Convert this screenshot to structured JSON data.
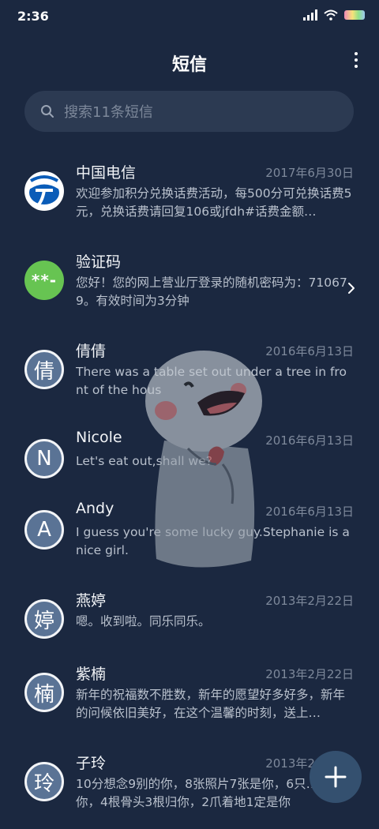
{
  "status_bar": {
    "time": "2:36"
  },
  "header": {
    "title": "短信"
  },
  "search": {
    "placeholder": "搜索11条短信"
  },
  "messages": [
    {
      "name": "中国电信",
      "date": "2017年6月30日",
      "preview": "欢迎参加积分兑换话费活动，每500分可兑换话费5元，兑换话费请回复106或jfdh#话费金额…",
      "avatar": "china-telecom-logo"
    },
    {
      "name": "验证码",
      "date": "",
      "preview": "您好！您的网上营业厅登录的随机密码为：710679。有效时间为3分钟",
      "avatar_text": "**-"
    },
    {
      "name": "倩倩",
      "date": "2016年6月13日",
      "preview": "There was a table set out under a tree in front of the hous",
      "avatar_text": "倩"
    },
    {
      "name": "Nicole",
      "date": "2016年6月13日",
      "preview": "Let's eat out,shall we?",
      "avatar_text": "N"
    },
    {
      "name": "Andy",
      "date": "2016年6月13日",
      "preview": "I guess you're some lucky guy.Stephanie is a nice girl.",
      "avatar_text": "A"
    },
    {
      "name": "燕婷",
      "date": "2013年2月22日",
      "preview": "嗯。收到啦。同乐同乐。",
      "avatar_text": "婷"
    },
    {
      "name": "紫楠",
      "date": "2013年2月22日",
      "preview": "新年的祝福数不胜数，新年的愿望好多好多，新年的问候依旧美好，在这个温馨的时刻，送上…",
      "avatar_text": "楠"
    },
    {
      "name": "子玲",
      "date": "2013年2月22日",
      "preview": "10分想念9别的你，8张照片7张是你，6只…只像你，4根骨头3根归你，2爪着地1定是你",
      "avatar_text": "玲"
    }
  ],
  "colors": {
    "background": "#1b2840",
    "search_bg": "#2c3a52",
    "avatar_letter_bg": "#5a7395",
    "verify_green": "#67c452",
    "fab_bg": "#34506f"
  },
  "icons": {
    "search": "search-icon",
    "more": "more-vertical-icon",
    "chevron": "chevron-right-icon",
    "fab": "plus-icon"
  }
}
